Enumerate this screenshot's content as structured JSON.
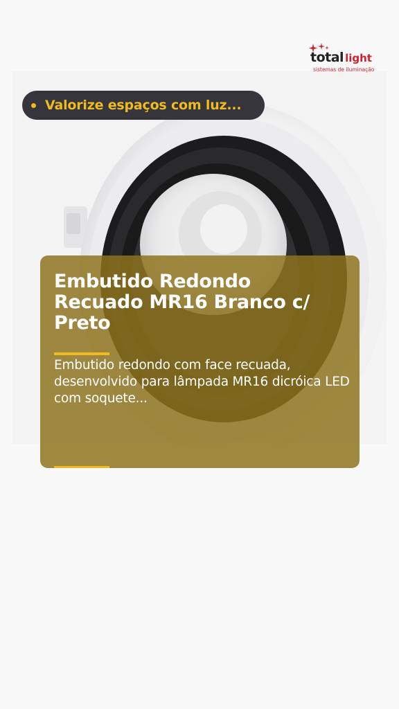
{
  "brand": {
    "name_part1": "total",
    "name_part2": "light",
    "tagline": "sistemas de iluminação",
    "primary_color": "#d1202f",
    "dark_color": "#222222"
  },
  "banner": {
    "text": "Valorize espaços com luz...",
    "text_color": "#f0bb1f",
    "background": "#35353b"
  },
  "product": {
    "title": "Embutido Redondo Recuado MR16 Branco c/ Preto",
    "description": "Embutido redondo com face recuada, desenvolvido para lâmpada MR16 dicróica LED com soquete...",
    "image": "recessed-round-downlight-white-black"
  },
  "colors": {
    "accent": "#f0bb1f",
    "card": "#8e731e",
    "page_background": "#f8f8f9"
  }
}
